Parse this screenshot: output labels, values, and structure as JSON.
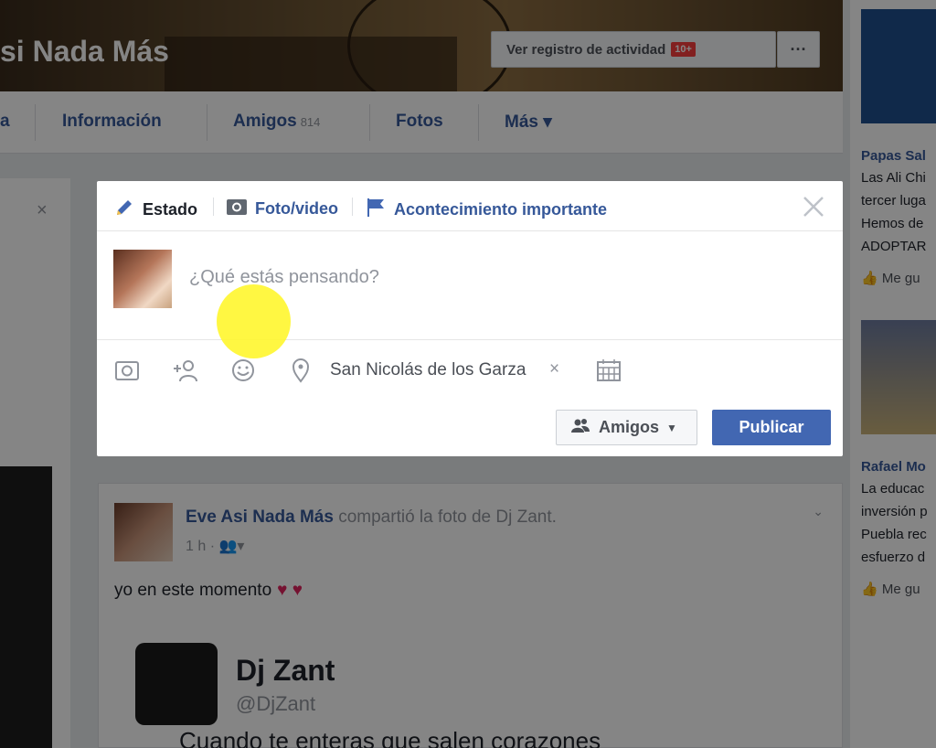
{
  "profile": {
    "cover_name": "si Nada Más",
    "activity_button": "Ver registro de actividad",
    "activity_badge": "10+",
    "more_button": "···"
  },
  "tabs": [
    {
      "label": "a"
    },
    {
      "label": "Información"
    },
    {
      "label": "Amigos",
      "count": "814"
    },
    {
      "label": "Fotos"
    },
    {
      "label": "Más ▾"
    }
  ],
  "composer": {
    "tabs": [
      {
        "label": "Estado",
        "icon": "pencil-icon",
        "active": true
      },
      {
        "label": "Foto/video",
        "icon": "camera-icon"
      },
      {
        "label": "Acontecimiento importante",
        "icon": "flag-icon"
      }
    ],
    "placeholder": "¿Qué estás pensando?",
    "location": "San Nicolás de los Garza",
    "location_clear": "×",
    "audience": "Amigos",
    "publish": "Publicar",
    "colors": {
      "publish_bg": "#4267b2",
      "link": "#365899"
    }
  },
  "post": {
    "author": "Eve Asi Nada Más",
    "action": "compartió la foto de Dj Zant.",
    "time": "1 h",
    "text": "yo en este momento",
    "hearts": "♥ ♥",
    "tweet": {
      "name": "Dj Zant",
      "handle": "@DjZant",
      "body": "Cuando te enteras que salen corazones"
    }
  },
  "right_rail": {
    "ad1": {
      "title": "Papas Sal",
      "lines": [
        "Las Ali Chi",
        "tercer luga",
        "Hemos de",
        "ADOPTAR"
      ],
      "like": "Me gu"
    },
    "ad2": {
      "title": "Rafael Mo",
      "lines": [
        "La educac",
        "inversión p",
        "Puebla rec",
        "esfuerzo d"
      ],
      "like": "Me gu"
    }
  },
  "left_rail": {
    "close": "×"
  }
}
